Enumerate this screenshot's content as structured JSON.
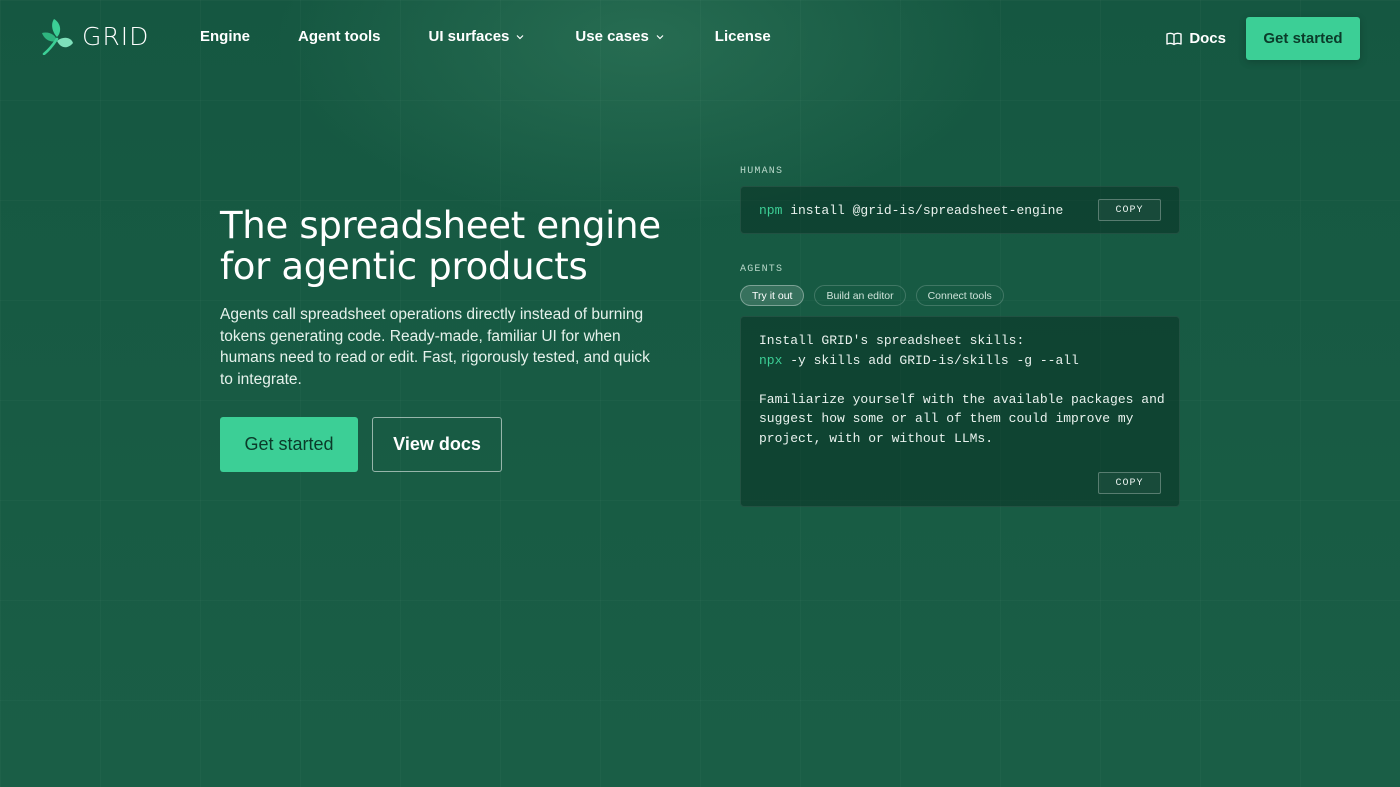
{
  "brand": {
    "name": "GRID",
    "colors": {
      "accent": "#3ccf96",
      "background": "#175a43",
      "button_text": "#0b3b2a"
    }
  },
  "nav": {
    "links": [
      {
        "label": "Engine",
        "has_dropdown": false
      },
      {
        "label": "Agent tools",
        "has_dropdown": false
      },
      {
        "label": "UI surfaces",
        "has_dropdown": true
      },
      {
        "label": "Use cases",
        "has_dropdown": true
      },
      {
        "label": "License",
        "has_dropdown": false
      }
    ],
    "docs_label": "Docs",
    "docs_icon": "book-icon",
    "cta_label": "Get started"
  },
  "hero": {
    "title_line1": "The spreadsheet engine",
    "title_line2": "for agentic products",
    "subtitle": "Agents call spreadsheet operations directly instead of burning tokens generating code. Ready-made, familiar UI for when humans need to read or edit. Fast, rigorously tested, and quick to integrate.",
    "primary_label": "Get started",
    "secondary_label": "View docs"
  },
  "humans": {
    "label": "HUMANS",
    "cmd_keyword": "npm",
    "cmd_rest": " install @grid-is/spreadsheet-engine",
    "copy_label": "COPY"
  },
  "agents": {
    "label": "AGENTS",
    "tabs": [
      "Try it out",
      "Build an editor",
      "Connect tools"
    ],
    "active_tab": "Try it out",
    "line1": "Install GRID's spreadsheet skills:",
    "line2_keyword": "npx",
    "line2_rest": " -y skills add GRID-is/skills -g --all",
    "line3": "Familiarize yourself with the available packages and",
    "line4": "suggest how some or all of them could improve my",
    "line5": "project, with or without LLMs.",
    "copy_label": "COPY"
  }
}
